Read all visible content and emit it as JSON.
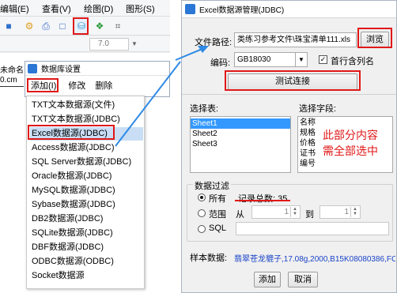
{
  "app": {
    "menu": [
      "编辑(E)",
      "查看(V)",
      "绘图(D)",
      "图形(S)"
    ],
    "font_size": "7.0",
    "untitled": "未命名",
    "ruler_left": "0.cm"
  },
  "db_settings": {
    "title": "数据库设置",
    "menu": {
      "add": "添加(I)",
      "modify": "修改",
      "delete": "删除"
    }
  },
  "dropdown": {
    "items": [
      "TXT文本数据源(文件)",
      "TXT文本数据源(JDBC)",
      "Excel数据源(JDBC)",
      "Access数据源(JDBC)",
      "SQL Server数据源(JDBC)",
      "Oracle数据源(JDBC)",
      "MySQL数据源(JDBC)",
      "Sybase数据源(JDBC)",
      "DB2数据源(JDBC)",
      "SQLite数据源(JDBC)",
      "DBF数据源(JDBC)",
      "ODBC数据源(ODBC)",
      "Socket数据源"
    ],
    "selected": "Excel数据源(JDBC)"
  },
  "dialog": {
    "title": "Excel数据源管理(JDBC)",
    "file_path_label": "文件路径:",
    "file_path_value": "类练习参考文件\\珠宝清单111.xls",
    "browse": "浏览",
    "encoding_label": "编码:",
    "encoding_value": "GB18030",
    "first_row_header": "首行含列名",
    "test_connection": "测试连接",
    "select_table_label": "选择表:",
    "tables": [
      "Sheet1",
      "Sheet2",
      "Sheet3"
    ],
    "select_fields_label": "选择字段:",
    "fields": [
      "名称",
      "规格",
      "价格",
      "证书",
      "编号"
    ],
    "annotation_line1": "此部分内容",
    "annotation_line2": "需全部选中",
    "filter_label": "数据过滤",
    "radio_all": "所有",
    "record_count": "记录总数: 35",
    "radio_range": "范围",
    "range_from": "从",
    "range_from_value": "1",
    "range_to": "到",
    "range_to_value": "1",
    "radio_sql": "SQL",
    "sample_label": "样本数据:",
    "sample_value": "翡翠苍龙貔子,17.08g,2000,B15K08080386,FC(",
    "add_button": "添加",
    "cancel_button": "取消"
  },
  "colors": {
    "highlight_red": "#e01818",
    "selection_blue": "#3399ff",
    "menu_selected": "#c9def5",
    "sample_blue": "#1a44c8",
    "arrow_blue": "#2f8ae6"
  }
}
